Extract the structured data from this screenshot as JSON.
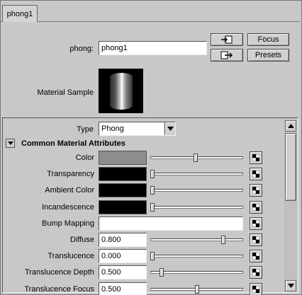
{
  "tab": {
    "label": "phong1"
  },
  "header": {
    "node_label": "phong:",
    "node_value": "phong1",
    "focus_label": "Focus",
    "presets_label": "Presets",
    "material_sample_label": "Material Sample"
  },
  "type_row": {
    "label": "Type",
    "value": "Phong"
  },
  "section": {
    "title": "Common Material Attributes"
  },
  "attributes": [
    {
      "label": "Color",
      "kind": "swatch",
      "swatch": "#8c8c8c",
      "slider": 0.49
    },
    {
      "label": "Transparency",
      "kind": "swatch",
      "swatch": "#000000",
      "slider": 0.0
    },
    {
      "label": "Ambient Color",
      "kind": "swatch",
      "swatch": "#000000",
      "slider": 0.0
    },
    {
      "label": "Incandescence",
      "kind": "swatch",
      "swatch": "#000000",
      "slider": 0.0
    },
    {
      "label": "Bump Mapping",
      "kind": "field",
      "value": ""
    },
    {
      "label": "Diffuse",
      "kind": "number",
      "value": "0.800",
      "slider": 0.8
    },
    {
      "label": "Translucence",
      "kind": "number",
      "value": "0.000",
      "slider": 0.0
    },
    {
      "label": "Translucence Depth",
      "kind": "number",
      "value": "0.500",
      "slider": 0.1
    },
    {
      "label": "Translucence Focus",
      "kind": "number",
      "value": "0.500",
      "slider": 0.5
    }
  ],
  "colors": {
    "background": "#c8c8c8",
    "field": "#ffffff"
  }
}
